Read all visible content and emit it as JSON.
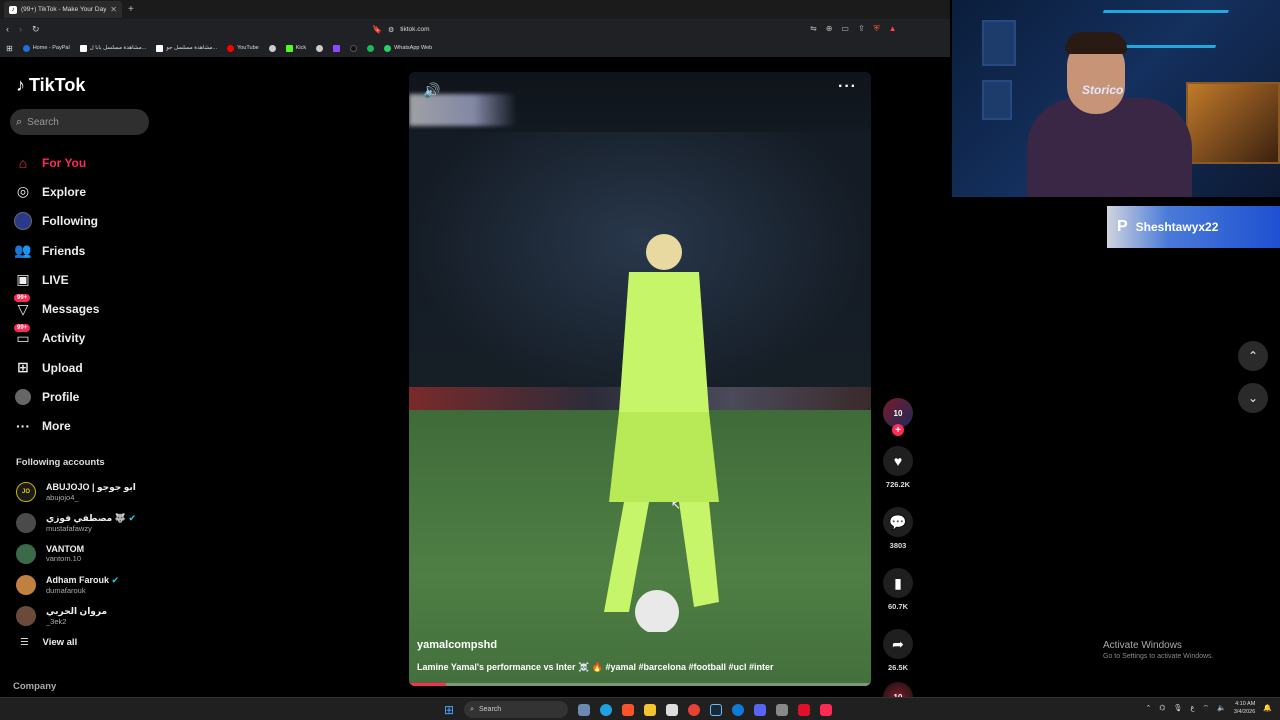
{
  "browser": {
    "tab_title": "(99+) TikTok - Make Your Day",
    "url": "tiktok.com",
    "bookmarks": [
      "Home - PayPal",
      "مشاهدة مسلسل بابا ل...",
      "مشاهدة مسلسل جو...",
      "YouTube",
      "Kick",
      "WhatsApp Web"
    ]
  },
  "sidebar": {
    "logo": "TikTok",
    "search_placeholder": "Search",
    "nav": [
      {
        "label": "For You",
        "icon": "home-icon",
        "active": true
      },
      {
        "label": "Explore",
        "icon": "compass-icon"
      },
      {
        "label": "Following",
        "icon": "following-avatar-icon"
      },
      {
        "label": "Friends",
        "icon": "friends-icon"
      },
      {
        "label": "LIVE",
        "icon": "live-icon"
      },
      {
        "label": "Messages",
        "icon": "messages-icon",
        "badge": "99+"
      },
      {
        "label": "Activity",
        "icon": "activity-icon",
        "badge": "99+"
      },
      {
        "label": "Upload",
        "icon": "upload-icon"
      },
      {
        "label": "Profile",
        "icon": "profile-icon"
      },
      {
        "label": "More",
        "icon": "more-icon"
      }
    ],
    "following_title": "Following accounts",
    "accounts": [
      {
        "name": "ABUJOJO | ابو جوجو",
        "user": "abujojo4_",
        "avatar": "JO",
        "color": "#1a1a1a"
      },
      {
        "name": "مصطفي فوزي 🐺",
        "user": "mustafafawzy",
        "avatar": "",
        "color": "#4a4a4a",
        "verified": true
      },
      {
        "name": "VANTOM",
        "user": "vantom.10",
        "avatar": "",
        "color": "#3a6a4a"
      },
      {
        "name": "Adham Farouk",
        "user": "dumafarouk",
        "avatar": "",
        "color": "#c08040",
        "verified": true
      },
      {
        "name": "مروان الحربي",
        "user": "_3ek2",
        "avatar": "",
        "color": "#6a4a3a"
      }
    ],
    "view_all": "View all",
    "company": "Company"
  },
  "video": {
    "author": "yamalcompshd",
    "caption": "Lamine Yamal's performance vs Inter ☠️ 🔥 #yamal #barcelona #football #ucl #inter",
    "progress": 0.08
  },
  "actions": {
    "likes": "726.2K",
    "comments": "3803",
    "saves": "60.7K",
    "shares": "26.5K"
  },
  "webcam": {
    "hoodie_text": "Storico",
    "ps_name": "Sheshtawyx22"
  },
  "windows": {
    "activate_title": "Activate Windows",
    "activate_sub": "Go to Settings to activate Windows.",
    "search": "Search",
    "time": "4:10 AM",
    "date": "3/4/2026"
  },
  "colors": {
    "accent": "#fe2c55"
  }
}
